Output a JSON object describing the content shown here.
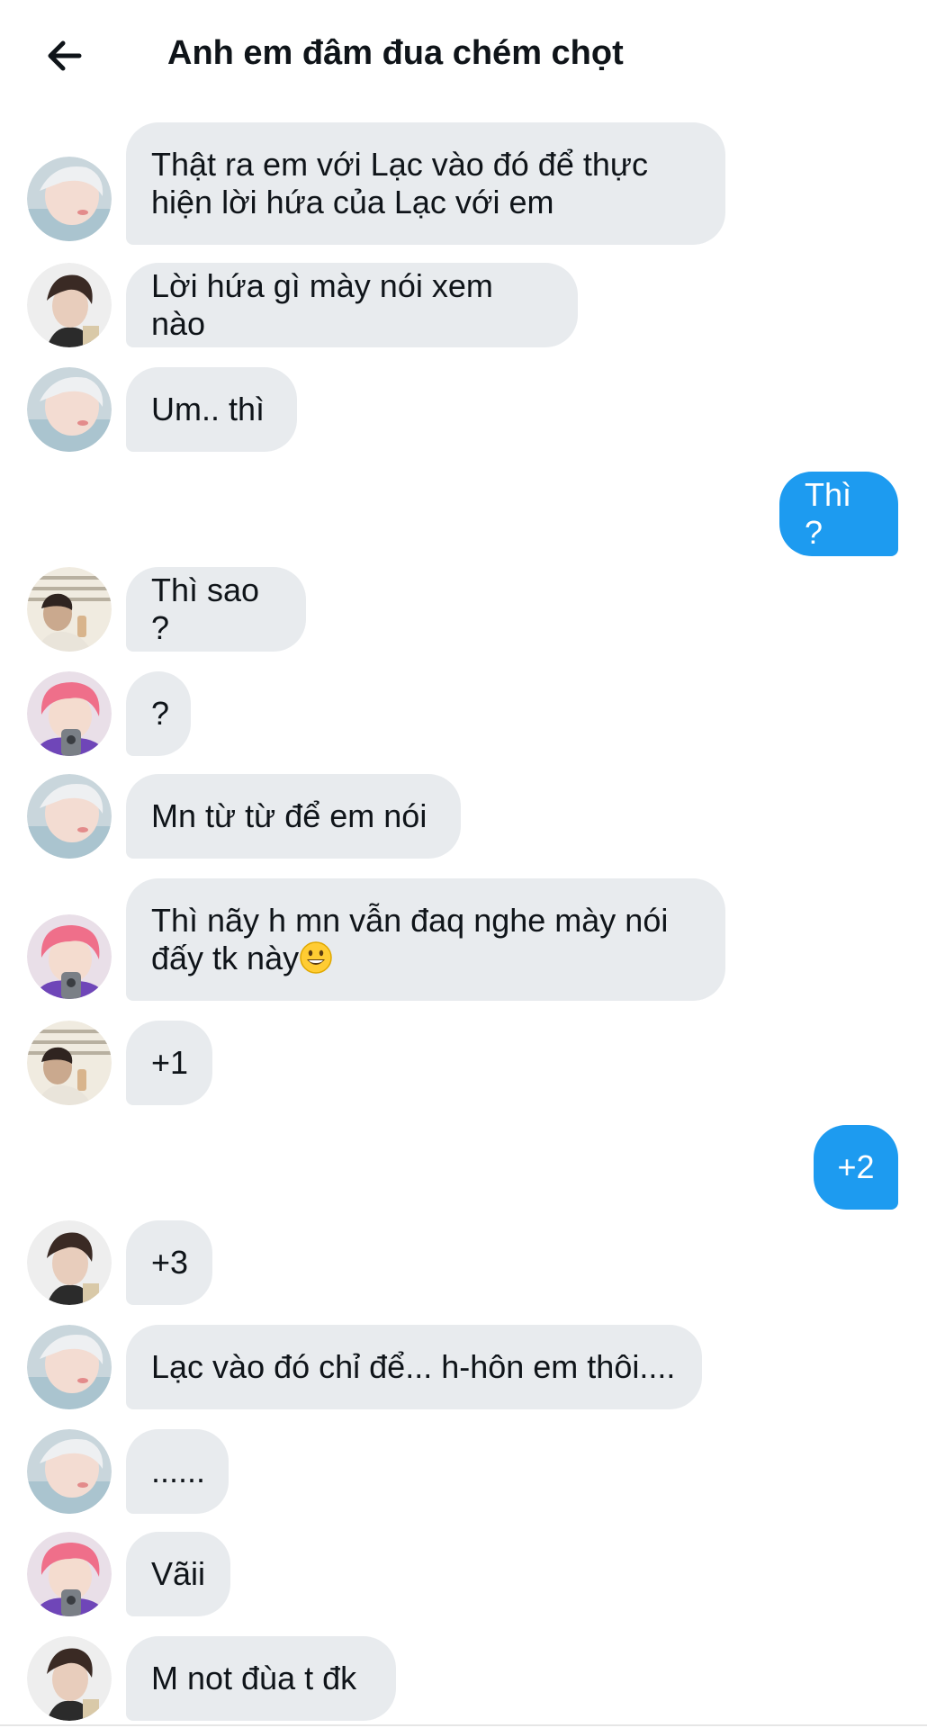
{
  "header": {
    "title": "Anh em đâm đua chém chọt",
    "back_icon": "arrow-left-icon"
  },
  "colors": {
    "incoming_bubble": "#e8ebee",
    "outgoing_bubble": "#1d9bf0",
    "text": "#0f1419"
  },
  "messages": [
    {
      "sender": "pale-hair-avatar",
      "direction": "in",
      "text": "Thật ra em với Lạc vào đó để thực\nhiện lời hứa của Lạc với em"
    },
    {
      "sender": "dark-hair-avatar",
      "direction": "in",
      "text": "Lời hứa gì mày nói xem nào"
    },
    {
      "sender": "pale-hair-avatar",
      "direction": "in",
      "text": "Um.. thì"
    },
    {
      "sender": "me",
      "direction": "out",
      "text": "Thì ?"
    },
    {
      "sender": "window-light-avatar",
      "direction": "in",
      "text": "Thì sao ?"
    },
    {
      "sender": "pink-hair-avatar",
      "direction": "in",
      "text": "?"
    },
    {
      "sender": "pale-hair-avatar",
      "direction": "in",
      "text": "Mn từ từ để em nói"
    },
    {
      "sender": "pink-hair-avatar",
      "direction": "in",
      "text": "Thì nãy h mn vẫn đaq nghe mày nói\nđấy tk này",
      "emoji": "grinning-face-emoji"
    },
    {
      "sender": "window-light-avatar",
      "direction": "in",
      "text": "+1"
    },
    {
      "sender": "me",
      "direction": "out",
      "text": "+2"
    },
    {
      "sender": "dark-hair-avatar",
      "direction": "in",
      "text": "+3"
    },
    {
      "sender": "pale-hair-avatar",
      "direction": "in",
      "text": "Lạc vào đó chỉ để... h-hôn em thôi...."
    },
    {
      "sender": "pale-hair-avatar",
      "direction": "in",
      "text": "......"
    },
    {
      "sender": "pink-hair-avatar",
      "direction": "in",
      "text": "Vãii"
    },
    {
      "sender": "dark-hair-avatar",
      "direction": "in",
      "text": "M not đùa t đk"
    }
  ]
}
